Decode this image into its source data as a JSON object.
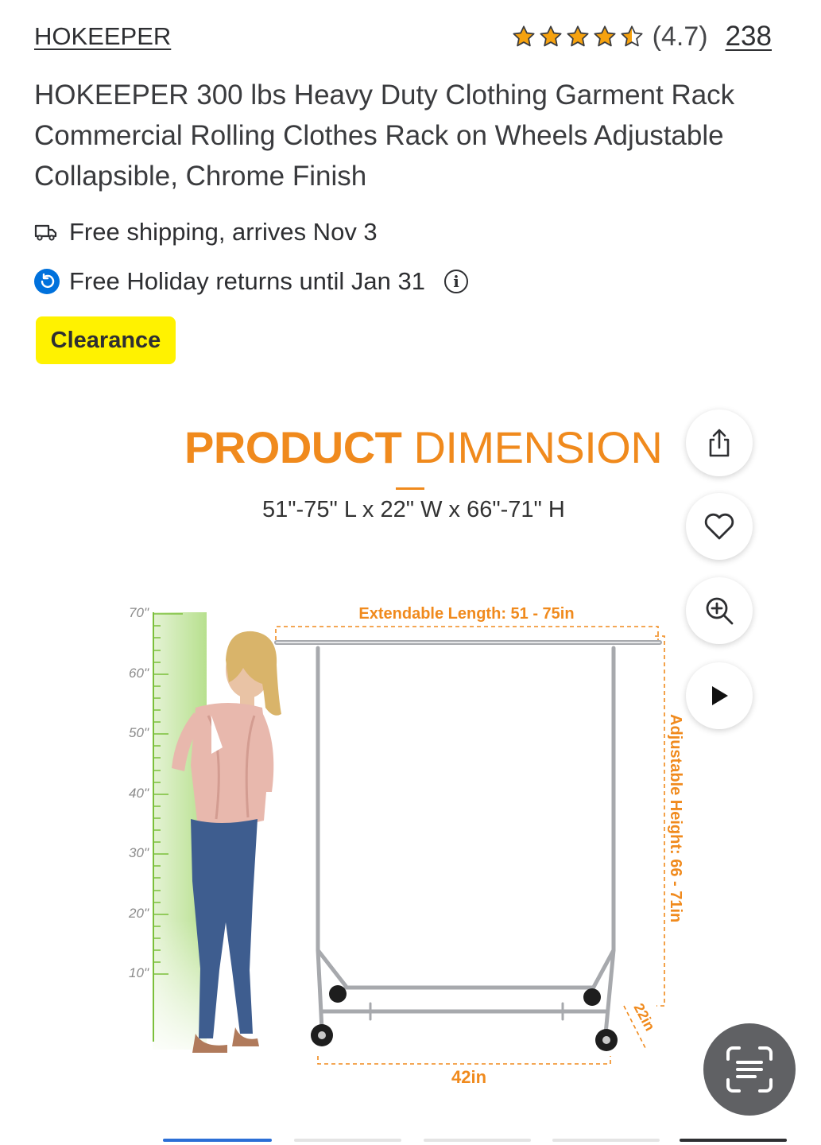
{
  "header": {
    "brand": "HOKEEPER",
    "rating_text": "(4.7)",
    "rating_value": 4.7,
    "review_count": "238",
    "star_color": "#f6a20f"
  },
  "product": {
    "title": "HOKEEPER 300 lbs Heavy Duty Clothing Garment Rack Commercial Rolling Clothes Rack on Wheels Adjustable Collapsible, Chrome Finish",
    "shipping": "Free shipping, arrives Nov 3",
    "returns": "Free Holiday returns until Jan 31",
    "badge": "Clearance",
    "badge_color": "#fff200"
  },
  "image": {
    "heading_bold": "PRODUCT",
    "heading_regular": "DIMENSION",
    "dimensions": "51\"-75\" L x 22\" W x 66\"-71\" H",
    "length_label": "Extendable Length: 51 - 75in",
    "height_label": "Adjustable Height: 66 - 71in",
    "width_label": "42in",
    "depth_label": "22in",
    "ruler_ticks": [
      "70\"",
      "60\"",
      "50\"",
      "40\"",
      "30\"",
      "20\"",
      "10\""
    ],
    "accent_color": "#f08a1d"
  },
  "actions": {
    "icons": [
      "share-icon",
      "heart-icon",
      "zoom-in-icon",
      "play-icon",
      "scan-icon"
    ]
  }
}
